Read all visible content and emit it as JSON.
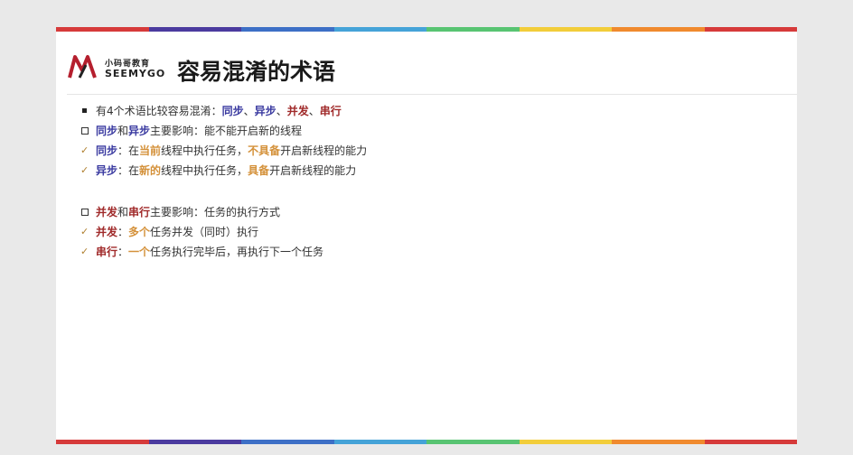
{
  "colors": {
    "rainbow": [
      "#d63a3a",
      "#4b3b9f",
      "#3d6fc6",
      "#45a3d8",
      "#58c472",
      "#f2cd3a",
      "#f08a2e",
      "#d63a3a"
    ],
    "blue": "#3a3aa0",
    "red": "#a02a2a",
    "orange": "#d4913a"
  },
  "logo": {
    "mark": "M",
    "chinese": "小码哥教育",
    "english": "SEEMYGO"
  },
  "title": "容易混淆的术语",
  "lines": [
    {
      "bullet": "square",
      "segments": [
        {
          "text": "有4个术语比较容易混淆：",
          "style": "plain"
        },
        {
          "text": "同步",
          "style": "blue"
        },
        {
          "text": "、",
          "style": "plain"
        },
        {
          "text": "异步",
          "style": "blue"
        },
        {
          "text": "、",
          "style": "plain"
        },
        {
          "text": "并发",
          "style": "red"
        },
        {
          "text": "、",
          "style": "plain"
        },
        {
          "text": "串行",
          "style": "red"
        }
      ]
    },
    {
      "bullet": "hollow",
      "segments": [
        {
          "text": "同步",
          "style": "blue"
        },
        {
          "text": "和",
          "style": "plain"
        },
        {
          "text": "异步",
          "style": "blue"
        },
        {
          "text": "主要影响：能不能开启新的线程",
          "style": "plain"
        }
      ]
    },
    {
      "bullet": "check",
      "segments": [
        {
          "text": "同步",
          "style": "blue"
        },
        {
          "text": "：在",
          "style": "plain"
        },
        {
          "text": "当前",
          "style": "orange"
        },
        {
          "text": "线程中执行任务，",
          "style": "plain"
        },
        {
          "text": "不具备",
          "style": "orange"
        },
        {
          "text": "开启新线程的能力",
          "style": "plain"
        }
      ]
    },
    {
      "bullet": "check",
      "segments": [
        {
          "text": "异步",
          "style": "blue"
        },
        {
          "text": "：在",
          "style": "plain"
        },
        {
          "text": "新的",
          "style": "orange"
        },
        {
          "text": "线程中执行任务，",
          "style": "plain"
        },
        {
          "text": "具备",
          "style": "orange"
        },
        {
          "text": "开启新线程的能力",
          "style": "plain"
        }
      ]
    },
    {
      "bullet": "hollow",
      "gap": true,
      "segments": [
        {
          "text": "并发",
          "style": "red"
        },
        {
          "text": "和",
          "style": "plain"
        },
        {
          "text": "串行",
          "style": "red"
        },
        {
          "text": "主要影响：任务的执行方式",
          "style": "plain"
        }
      ]
    },
    {
      "bullet": "check",
      "segments": [
        {
          "text": "并发",
          "style": "red"
        },
        {
          "text": "：",
          "style": "plain"
        },
        {
          "text": "多个",
          "style": "orange"
        },
        {
          "text": "任务并发（同时）执行",
          "style": "plain"
        }
      ]
    },
    {
      "bullet": "check",
      "segments": [
        {
          "text": "串行",
          "style": "red"
        },
        {
          "text": "：",
          "style": "plain"
        },
        {
          "text": "一个",
          "style": "orange"
        },
        {
          "text": "任务执行完毕后，再执行下一个任务",
          "style": "plain"
        }
      ]
    }
  ]
}
